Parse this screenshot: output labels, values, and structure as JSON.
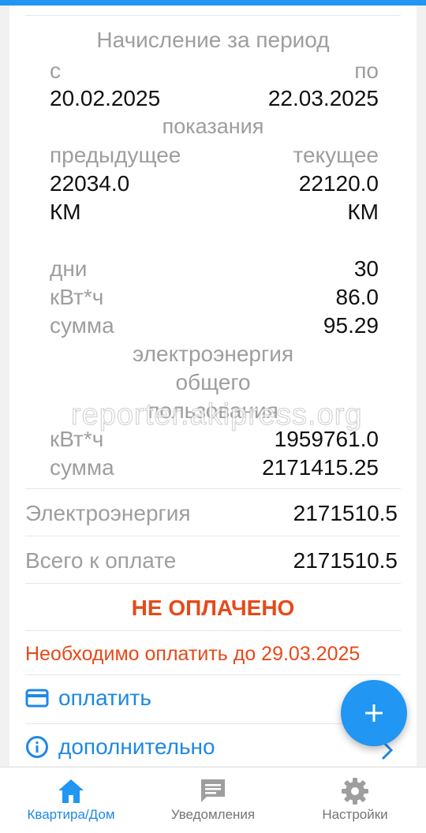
{
  "accrual": {
    "heading": "Начисление за период",
    "from_label": "с",
    "to_label": "по",
    "from_date": "20.02.2025",
    "to_date": "22.03.2025",
    "readings_heading": "показания",
    "prev_label": "предыдущее",
    "curr_label": "текущее",
    "prev_value": "22034.0",
    "curr_value": "22120.0",
    "prev_unit": "КМ",
    "curr_unit": "КМ",
    "days_label": "дни",
    "days_value": "30",
    "kwh_label": "кВт*ч",
    "kwh_value": "86.0",
    "sum_label": "сумма",
    "sum_value": "95.29",
    "common_heading_1": "электроэнергия",
    "common_heading_2": "общего",
    "common_heading_3": "пользования",
    "common_kwh_label": "кВт*ч",
    "common_kwh_value": "1959761.0",
    "common_sum_label": "сумма",
    "common_sum_value": "2171415.25"
  },
  "summary": {
    "electricity_label": "Электроэнергия",
    "electricity_value": "2171510.5",
    "total_label": "Всего к оплате",
    "total_value": "2171510.5",
    "status": "НЕ ОПЛАЧЕНО",
    "due_text": "Необходимо оплатить до 29.03.2025"
  },
  "actions": {
    "pay_label": "оплатить",
    "more_label": "дополнительно"
  },
  "watermark": "reporter.akipress.org",
  "nav": {
    "items": [
      {
        "label": "Квартира/Дом",
        "icon": "home-icon",
        "active": true
      },
      {
        "label": "Уведомления",
        "icon": "message-icon",
        "active": false
      },
      {
        "label": "Настройки",
        "icon": "gear-icon",
        "active": false
      }
    ]
  },
  "colors": {
    "accent": "#2196f3",
    "link": "#1e88e5",
    "alert": "#e64a19",
    "muted": "#9e9e9e"
  }
}
